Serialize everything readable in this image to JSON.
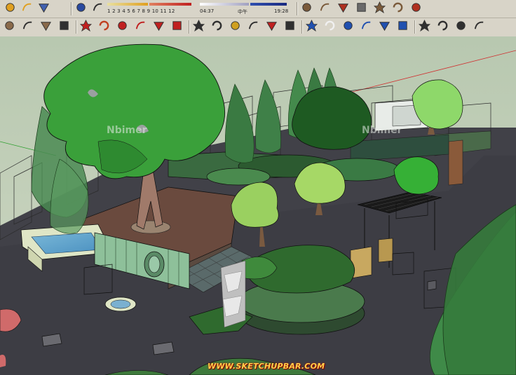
{
  "app": {
    "name": "SketchUp"
  },
  "shadow_settings": {
    "month_ticks": "1 2 3 4 5 6 7 8 9 10 11 12",
    "time_start": "04:37",
    "time_mid": "中午",
    "time_end": "19:28"
  },
  "toolbar_row1": [
    {
      "name": "shadow-settings-icon",
      "color": "#e0a020"
    },
    {
      "name": "fog-icon",
      "color": "#e0a020"
    },
    {
      "name": "section-plane-icon",
      "color": "#4060b0"
    },
    {
      "name": "model-info-icon",
      "color": "#2a4aa0"
    },
    {
      "name": "components-icon",
      "color": "#303030"
    },
    {
      "name": "style-xray-icon",
      "color": "#7a5a3a"
    },
    {
      "name": "style-wireframe-icon",
      "color": "#7a5a3a"
    },
    {
      "name": "style-hidden-line-icon",
      "color": "#b03020"
    },
    {
      "name": "style-shaded-icon",
      "color": "#6a6a6a"
    },
    {
      "name": "style-shaded-textures-icon",
      "color": "#7a5a3a"
    },
    {
      "name": "style-monochrome-icon",
      "color": "#7a5a3a"
    },
    {
      "name": "style-back-edges-icon",
      "color": "#b03020"
    }
  ],
  "toolbar_row2": [
    {
      "name": "circle-tool-icon",
      "color": "#8a6a4a"
    },
    {
      "name": "arc-tool-icon",
      "color": "#303030"
    },
    {
      "name": "polygon-tool-icon",
      "color": "#8a6a4a"
    },
    {
      "name": "freehand-tool-icon",
      "color": "#303030"
    },
    {
      "name": "move-tool-icon",
      "color": "#c02020"
    },
    {
      "name": "push-pull-tool-icon",
      "color": "#c04020"
    },
    {
      "name": "rotate-tool-icon",
      "color": "#c02020"
    },
    {
      "name": "follow-me-tool-icon",
      "color": "#c02020"
    },
    {
      "name": "scale-tool-icon",
      "color": "#c02020"
    },
    {
      "name": "offset-tool-icon",
      "color": "#c02020"
    },
    {
      "name": "tape-measure-icon",
      "color": "#303030"
    },
    {
      "name": "dimension-tool-icon",
      "color": "#303030"
    },
    {
      "name": "protractor-icon",
      "color": "#d0a020"
    },
    {
      "name": "text-tool-icon",
      "color": "#303030"
    },
    {
      "name": "axes-tool-icon",
      "color": "#c02020"
    },
    {
      "name": "3d-text-icon",
      "color": "#303030"
    },
    {
      "name": "orbit-tool-icon",
      "color": "#2050b0"
    },
    {
      "name": "pan-tool-icon",
      "color": "#f0f0f0"
    },
    {
      "name": "zoom-tool-icon",
      "color": "#2050b0"
    },
    {
      "name": "zoom-window-icon",
      "color": "#2050b0"
    },
    {
      "name": "zoom-extents-icon",
      "color": "#2050b0"
    },
    {
      "name": "previous-view-icon",
      "color": "#2050b0"
    },
    {
      "name": "position-camera-icon",
      "color": "#303030"
    },
    {
      "name": "look-around-icon",
      "color": "#303030"
    },
    {
      "name": "walk-tool-icon",
      "color": "#303030"
    },
    {
      "name": "section-plane-tool-icon",
      "color": "#303030"
    }
  ],
  "viewport": {
    "watermarks": [
      "Nbimer",
      "Nbimer"
    ],
    "source_url": "WWW.SKETCHUPBAR.COM"
  }
}
